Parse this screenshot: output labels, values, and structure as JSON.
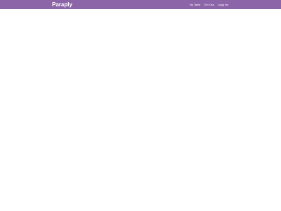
{
  "navbar": {
    "background": "#8c64a8",
    "brand": "Paraply",
    "links": [
      "Ny Takst",
      "Om Oss",
      "Logg inn"
    ]
  }
}
